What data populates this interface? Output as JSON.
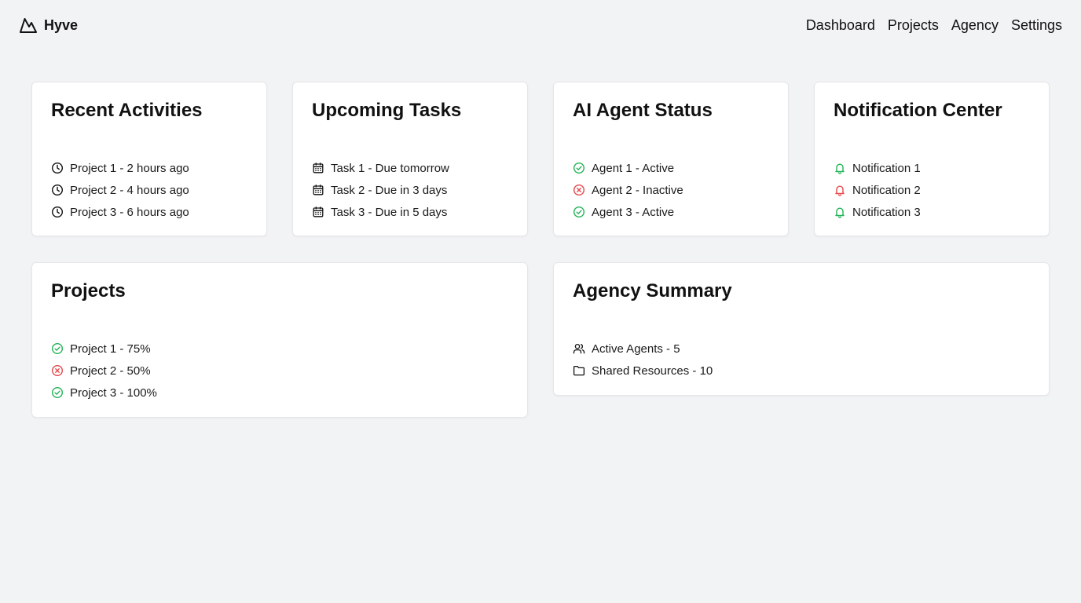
{
  "app": {
    "name": "Hyve",
    "logo_icon": "mountain-logo-icon"
  },
  "nav": {
    "items": [
      {
        "label": "Dashboard"
      },
      {
        "label": "Projects"
      },
      {
        "label": "Agency"
      },
      {
        "label": "Settings"
      }
    ]
  },
  "colors": {
    "background": "#f2f3f5",
    "card": "#ffffff",
    "success": "#22b357",
    "error": "#e5484d",
    "text": "#111111"
  },
  "recent_activities": {
    "title": "Recent Activities",
    "items": [
      {
        "label": "Project 1 - 2 hours ago",
        "icon": "clock-icon"
      },
      {
        "label": "Project 2 - 4 hours ago",
        "icon": "clock-icon"
      },
      {
        "label": "Project 3 - 6 hours ago",
        "icon": "clock-icon"
      }
    ]
  },
  "upcoming_tasks": {
    "title": "Upcoming Tasks",
    "items": [
      {
        "label": "Task 1 - Due tomorrow",
        "icon": "calendar-icon"
      },
      {
        "label": "Task 2 - Due in 3 days",
        "icon": "calendar-icon"
      },
      {
        "label": "Task 3 - Due in 5 days",
        "icon": "calendar-icon"
      }
    ]
  },
  "agent_status": {
    "title": "AI Agent Status",
    "items": [
      {
        "label": "Agent 1 - Active",
        "icon": "check-circle-icon",
        "status": "success"
      },
      {
        "label": "Agent 2 - Inactive",
        "icon": "x-circle-icon",
        "status": "error"
      },
      {
        "label": "Agent 3 - Active",
        "icon": "check-circle-icon",
        "status": "success"
      }
    ]
  },
  "notifications": {
    "title": "Notification Center",
    "items": [
      {
        "label": "Notification 1",
        "icon": "bell-icon",
        "status": "success"
      },
      {
        "label": "Notification 2",
        "icon": "bell-icon",
        "status": "error"
      },
      {
        "label": "Notification 3",
        "icon": "bell-icon",
        "status": "success"
      }
    ]
  },
  "projects": {
    "title": "Projects",
    "items": [
      {
        "label": "Project 1 - 75%",
        "icon": "check-circle-icon",
        "status": "success"
      },
      {
        "label": "Project 2 - 50%",
        "icon": "x-circle-icon",
        "status": "error"
      },
      {
        "label": "Project 3 - 100%",
        "icon": "check-circle-icon",
        "status": "success"
      }
    ]
  },
  "agency_summary": {
    "title": "Agency Summary",
    "items": [
      {
        "label": "Active Agents - 5",
        "icon": "users-icon"
      },
      {
        "label": "Shared Resources - 10",
        "icon": "folder-icon"
      }
    ]
  }
}
